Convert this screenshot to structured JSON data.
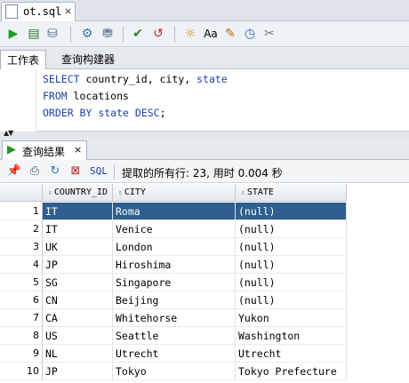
{
  "file_tab": {
    "label": "ot.sql",
    "close": "×"
  },
  "worksheet_tabs": [
    "工作表",
    "查询构建器"
  ],
  "editor": {
    "lines": [
      {
        "kw": "SELECT",
        "text": " country_id, city, ",
        "kw2": "state",
        "tail": ""
      },
      {
        "kw": "FROM",
        "text": " locations",
        "kw2": "",
        "tail": ""
      },
      {
        "kw": "ORDER BY",
        "text": " ",
        "kw2": "state DESC",
        "tail": ";"
      }
    ]
  },
  "results": {
    "tab_label": "查询结果",
    "tab_close": "×",
    "sql_label": "SQL",
    "status": "提取的所有行: 23, 用时 0.004 秒",
    "columns": [
      "COUNTRY_ID",
      "CITY",
      "STATE"
    ],
    "rows": [
      {
        "n": "1",
        "country": "IT",
        "city": "Roma",
        "state": "(null)"
      },
      {
        "n": "2",
        "country": "IT",
        "city": "Venice",
        "state": "(null)"
      },
      {
        "n": "3",
        "country": "UK",
        "city": "London",
        "state": "(null)"
      },
      {
        "n": "4",
        "country": "JP",
        "city": "Hiroshima",
        "state": "(null)"
      },
      {
        "n": "5",
        "country": "SG",
        "city": "Singapore",
        "state": "(null)"
      },
      {
        "n": "6",
        "country": "CN",
        "city": "Beijing",
        "state": "(null)"
      },
      {
        "n": "7",
        "country": "CA",
        "city": "Whitehorse",
        "state": "Yukon"
      },
      {
        "n": "8",
        "country": "US",
        "city": "Seattle",
        "state": "Washington"
      },
      {
        "n": "9",
        "country": "NL",
        "city": "Utrecht",
        "state": "Utrecht"
      },
      {
        "n": "10",
        "country": "JP",
        "city": "Tokyo",
        "state": "Tokyo Prefecture"
      }
    ],
    "selected_row": 1
  },
  "icons": {
    "run": "run-statement-icon",
    "run_script": "run-script-icon",
    "selection_color": "#2e5f8e"
  }
}
